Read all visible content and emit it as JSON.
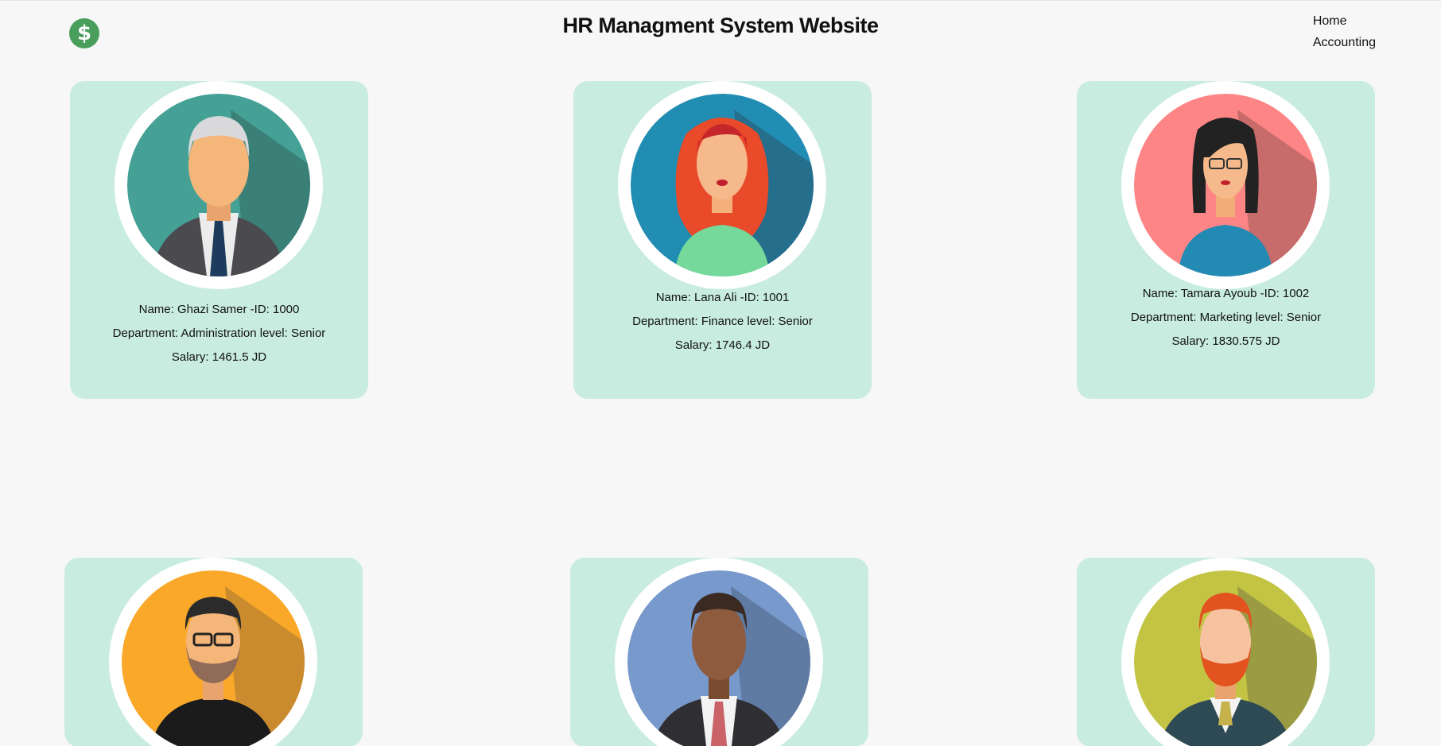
{
  "header": {
    "logo_icon": "dollar-icon",
    "logo_glyph": "$",
    "title": "HR Managment System Website",
    "nav": [
      {
        "label": "Home"
      },
      {
        "label": "Accounting"
      }
    ]
  },
  "employees": [
    {
      "name_line": "Name: Ghazi Samer -ID: 1000",
      "dept_line": "Department: Administration level: Senior",
      "salary_line": "Salary: 1461.5 JD",
      "avatar_icon": "grey-haired-man-avatar-icon"
    },
    {
      "name_line": "Name: Lana Ali -ID: 1001",
      "dept_line": "Department: Finance level: Senior",
      "salary_line": "Salary: 1746.4 JD",
      "avatar_icon": "red-haired-woman-avatar-icon"
    },
    {
      "name_line": "Name: Tamara Ayoub -ID: 1002",
      "dept_line": "Department: Marketing level: Senior",
      "salary_line": "Salary: 1830.575 JD",
      "avatar_icon": "woman-with-glasses-avatar-icon"
    },
    {
      "avatar_icon": "bearded-man-glasses-avatar-icon"
    },
    {
      "avatar_icon": "man-in-suit-avatar-icon"
    },
    {
      "avatar_icon": "red-bearded-man-avatar-icon"
    }
  ],
  "colors": {
    "page_bg": "#f7f7f7",
    "card_bg": "#c8ece0",
    "logo_green": "#4a9e5c"
  }
}
